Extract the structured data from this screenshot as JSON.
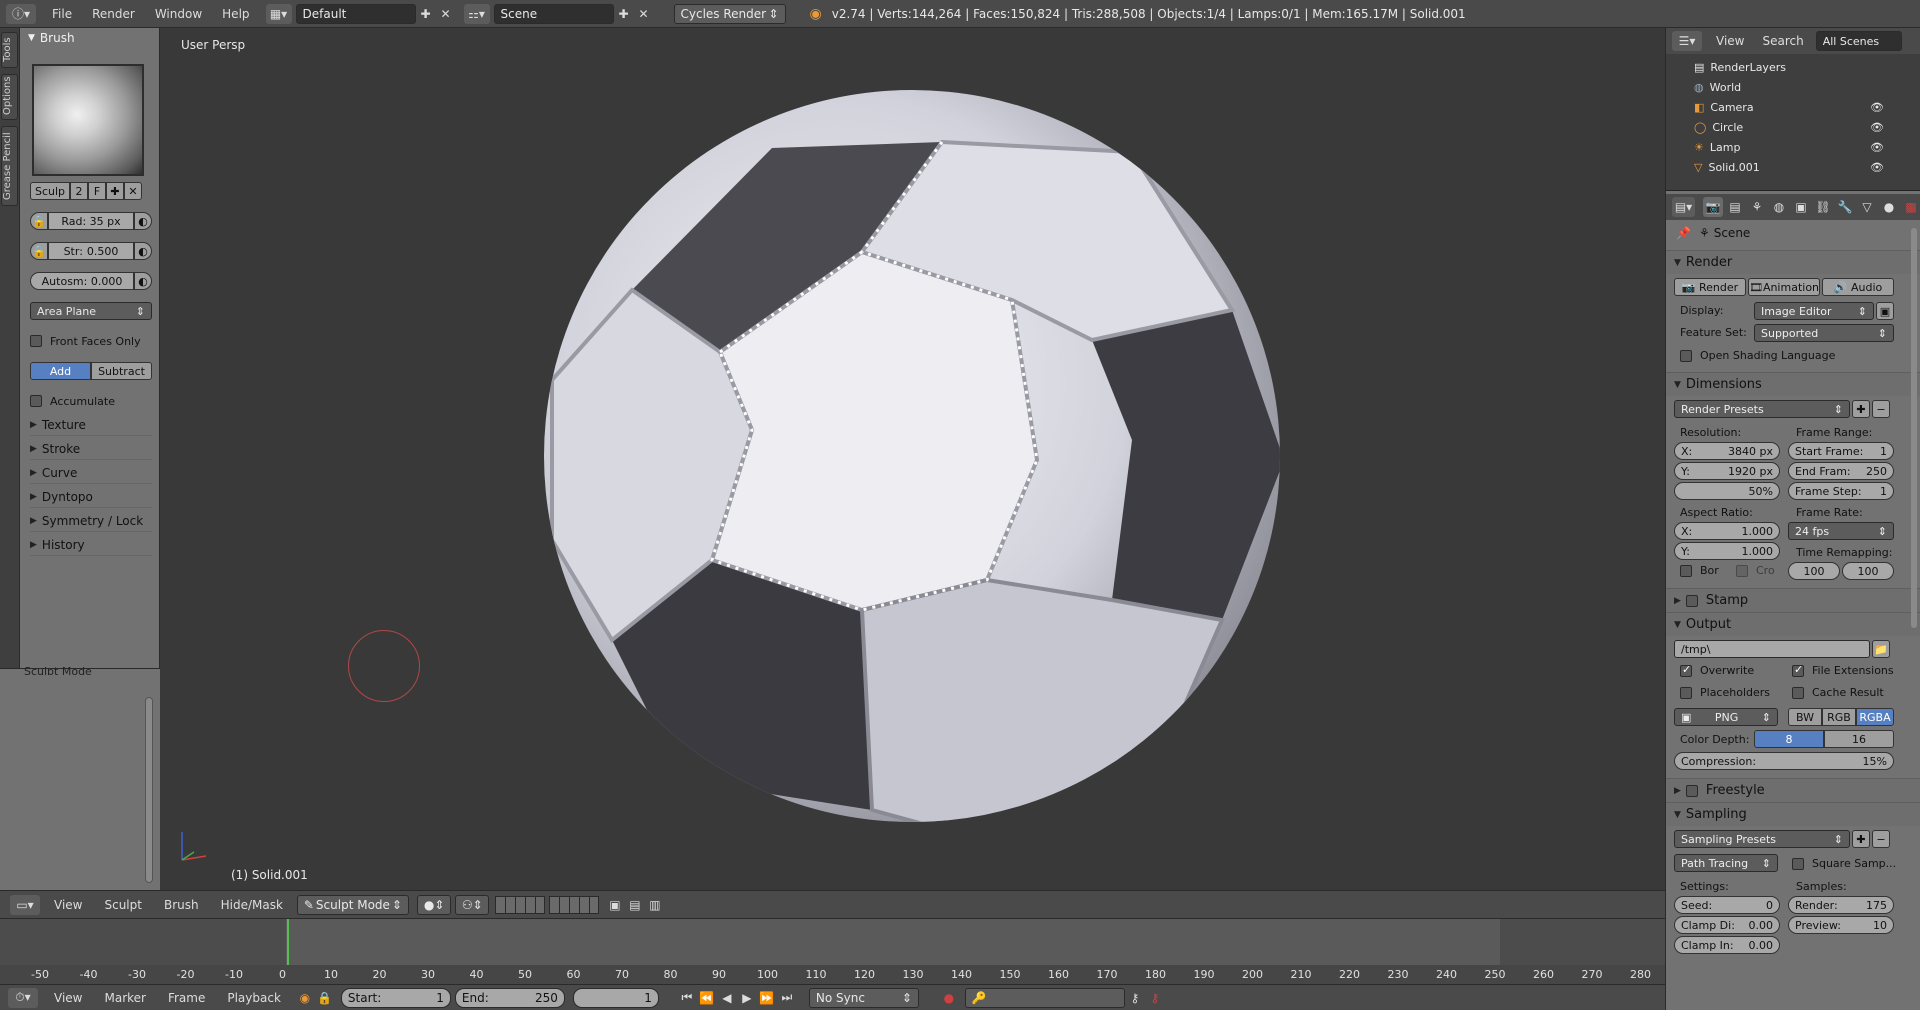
{
  "topbar": {
    "menus": [
      "File",
      "Render",
      "Window",
      "Help"
    ],
    "layout": "Default",
    "scene": "Scene",
    "engine": "Cycles Render",
    "info": "v2.74 | Verts:144,264 | Faces:150,824 | Tris:288,508 | Objects:1/4 | Lamps:0/1 | Mem:165.17M | Solid.001"
  },
  "lefttabs": [
    "Tools",
    "Options",
    "Grease Pencil"
  ],
  "toolshelf": {
    "panel": "Brush",
    "brush_name": "Sculp",
    "brush_users": "2",
    "brush_f": "F",
    "radius": "Rad: 35 px",
    "strength_label": "Str:",
    "strength_value": "0.500",
    "autosmooth": "Autosm: 0.000",
    "plane": "Area Plane",
    "front_faces": "Front Faces Only",
    "add": "Add",
    "subtract": "Subtract",
    "accumulate": "Accumulate",
    "panels": [
      "Texture",
      "Stroke",
      "Curve",
      "Dyntopo",
      "Symmetry / Lock",
      "History"
    ],
    "sculpt_mode_title": "Sculpt Mode"
  },
  "viewport": {
    "label": "User Persp",
    "object": "(1) Solid.001"
  },
  "vpheader": {
    "menus": [
      "View",
      "Sculpt",
      "Brush",
      "Hide/Mask"
    ],
    "mode": "Sculpt Mode"
  },
  "timeline": {
    "ticks": [
      "-50",
      "-40",
      "-30",
      "-20",
      "-10",
      "0",
      "10",
      "20",
      "30",
      "40",
      "50",
      "60",
      "70",
      "80",
      "90",
      "100",
      "110",
      "120",
      "130",
      "140",
      "150",
      "160",
      "170",
      "180",
      "190",
      "200",
      "210",
      "220",
      "230",
      "240",
      "250",
      "260",
      "270",
      "280"
    ],
    "current_frame": "1",
    "start": "Start:",
    "start_val": "1",
    "end": "End:",
    "end_val": "250",
    "sync": "No Sync",
    "menus": [
      "View",
      "Marker",
      "Frame",
      "Playback"
    ]
  },
  "outliner": {
    "view": "View",
    "search": "Search",
    "filter": "All Scenes",
    "items": [
      "RenderLayers",
      "World",
      "Camera",
      "Circle",
      "Lamp",
      "Solid.001"
    ]
  },
  "properties": {
    "context": "Scene",
    "render": {
      "title": "Render",
      "btn_render": "Render",
      "btn_anim": "Animation",
      "btn_audio": "Audio",
      "display_label": "Display:",
      "display": "Image Editor",
      "featureset_label": "Feature Set:",
      "featureset": "Supported",
      "osl": "Open Shading Language"
    },
    "dimensions": {
      "title": "Dimensions",
      "presets": "Render Presets",
      "resolution": "Resolution:",
      "res_x_label": "X:",
      "res_x": "3840 px",
      "res_y_label": "Y:",
      "res_y": "1920 px",
      "res_pct": "50%",
      "frame_range": "Frame Range:",
      "start_label": "Start Frame:",
      "start": "1",
      "end_label": "End Fram:",
      "end": "250",
      "step_label": "Frame Step:",
      "step": "1",
      "aspect": "Aspect Ratio:",
      "asp_x_label": "X:",
      "asp_x": "1.000",
      "asp_y_label": "Y:",
      "asp_y": "1.000",
      "framerate": "Frame Rate:",
      "fps": "24 fps",
      "time_remap": "Time Remapping:",
      "remap_old": "100",
      "remap_new": "100",
      "border": "Bor",
      "crop": "Cro"
    },
    "stamp": "Stamp",
    "output": {
      "title": "Output",
      "path": "/tmp\\",
      "overwrite": "Overwrite",
      "file_ext": "File Extensions",
      "placeholders": "Placeholders",
      "cache": "Cache Result",
      "format": "PNG",
      "bw": "BW",
      "rgb": "RGB",
      "rgba": "RGBA",
      "depth_label": "Color Depth:",
      "depth8": "8",
      "depth16": "16",
      "compression": "Compression:",
      "compression_val": "15%"
    },
    "freestyle": "Freestyle",
    "sampling": {
      "title": "Sampling",
      "presets": "Sampling Presets",
      "method": "Path Tracing",
      "square": "Square Samp...",
      "settings": "Settings:",
      "samples": "Samples:",
      "seed_label": "Seed:",
      "seed": "0",
      "render_label": "Render:",
      "render": "175",
      "clamp_d_label": "Clamp Di:",
      "clamp_d": "0.00",
      "preview_label": "Preview:",
      "preview": "10",
      "clamp_i_label": "Clamp In:",
      "clamp_i": "0.00"
    }
  }
}
